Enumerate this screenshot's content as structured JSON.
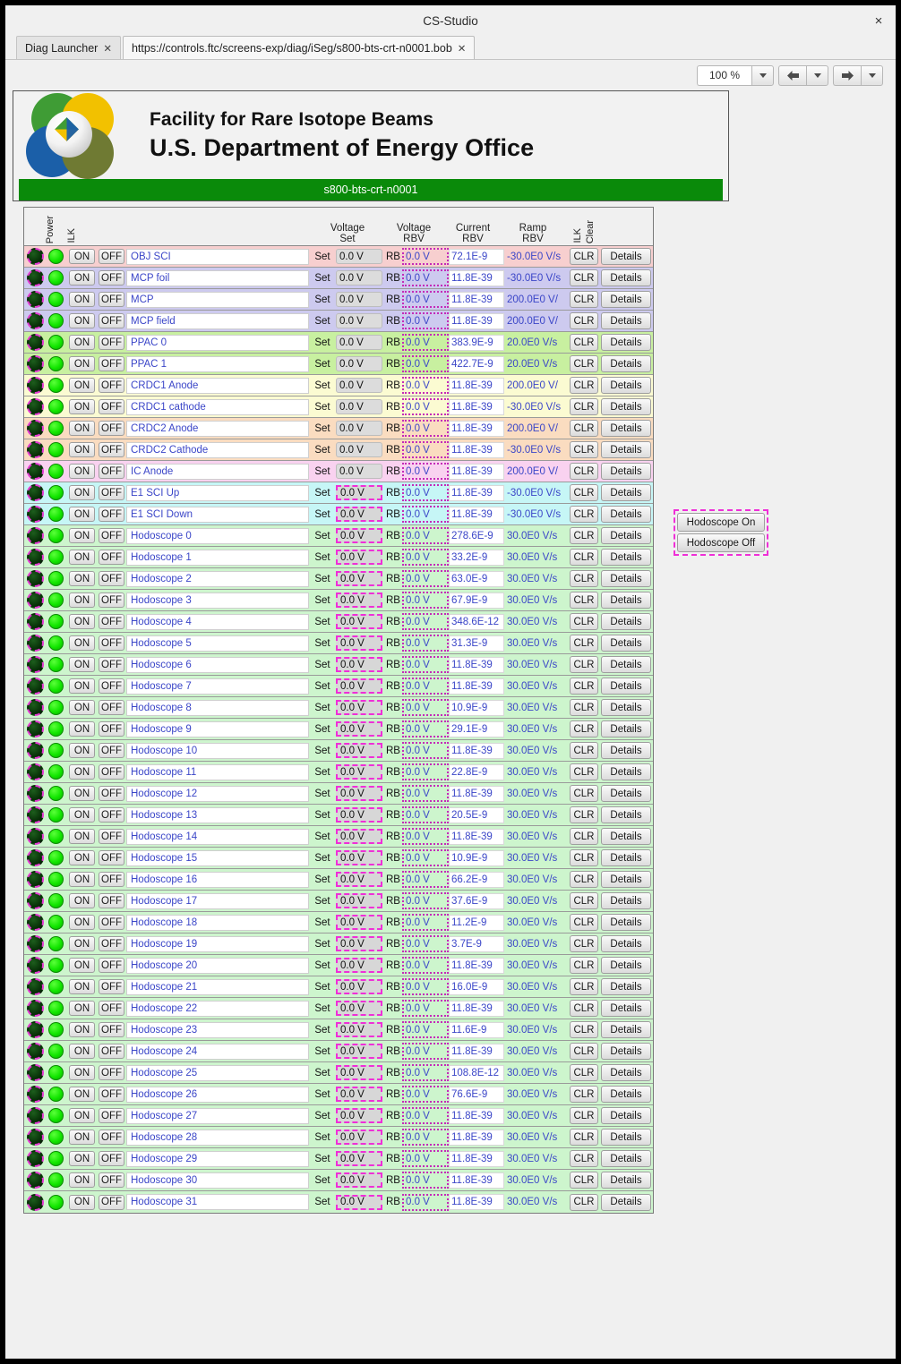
{
  "window": {
    "title": "CS-Studio",
    "close_label": "×"
  },
  "tabs": [
    {
      "label": "Diag Launcher",
      "close": "✕",
      "active": false
    },
    {
      "label": "https://controls.ftc/screens-exp/diag/iSeg/s800-bts-crt-n0001.bob",
      "close": "✕",
      "active": true
    }
  ],
  "toolbar": {
    "zoom_value": "100 %"
  },
  "banner": {
    "line1": "Facility for Rare Isotope Beams",
    "line2": "U.S. Department of Energy Office",
    "status_bar": "s800-bts-crt-n0001",
    "status_color": "#0a8a0a"
  },
  "table": {
    "headers": {
      "power": "Power",
      "ilk": "ILK",
      "voltage_set_1": "Voltage",
      "voltage_set_2": "Set",
      "voltage_rbv_1": "Voltage",
      "voltage_rbv_2": "RBV",
      "current_rbv_1": "Current",
      "current_rbv_2": "RBV",
      "ramp_rbv_1": "Ramp",
      "ramp_rbv_2": "RBV",
      "ilk_clear_1": "ILK",
      "ilk_clear_2": "Clear"
    },
    "labels": {
      "on": "ON",
      "off": "OFF",
      "set": "Set",
      "rb": "RB",
      "clr": "CLR",
      "details": "Details"
    },
    "rows": [
      {
        "name": "OBJ SCI",
        "vset": "0.0 V",
        "vrbv": "0.0 V",
        "crbv": "72.1E-9",
        "rrbv": "-30.0E0 V/s",
        "bg": "#f7cfcf",
        "hl_set": false
      },
      {
        "name": "MCP foil",
        "vset": "0.0 V",
        "vrbv": "0.0 V",
        "crbv": "11.8E-39",
        "rrbv": "-30.0E0 V/s",
        "bg": "#cdcaef",
        "hl_set": false
      },
      {
        "name": "MCP",
        "vset": "0.0 V",
        "vrbv": "0.0 V",
        "crbv": "11.8E-39",
        "rrbv": "200.0E0 V/",
        "bg": "#cdcaef",
        "hl_set": false
      },
      {
        "name": "MCP field",
        "vset": "0.0 V",
        "vrbv": "0.0 V",
        "crbv": "11.8E-39",
        "rrbv": "200.0E0 V/",
        "bg": "#cdcaef",
        "hl_set": false
      },
      {
        "name": "PPAC 0",
        "vset": "0.0 V",
        "vrbv": "0.0 V",
        "crbv": "383.9E-9",
        "rrbv": "20.0E0 V/s",
        "bg": "#c8f0a0",
        "hl_set": false
      },
      {
        "name": "PPAC 1",
        "vset": "0.0 V",
        "vrbv": "0.0 V",
        "crbv": "422.7E-9",
        "rrbv": "20.0E0 V/s",
        "bg": "#c8f0a0",
        "hl_set": false
      },
      {
        "name": "CRDC1 Anode",
        "vset": "0.0 V",
        "vrbv": "0.0 V",
        "crbv": "11.8E-39",
        "rrbv": "200.0E0 V/",
        "bg": "#fbfbd2",
        "hl_set": false
      },
      {
        "name": "CRDC1 cathode",
        "vset": "0.0 V",
        "vrbv": "0.0 V",
        "crbv": "11.8E-39",
        "rrbv": "-30.0E0 V/s",
        "bg": "#fbfbd2",
        "hl_set": false
      },
      {
        "name": "CRDC2 Anode",
        "vset": "0.0 V",
        "vrbv": "0.0 V",
        "crbv": "11.8E-39",
        "rrbv": "200.0E0 V/",
        "bg": "#fadcc0",
        "hl_set": false
      },
      {
        "name": "CRDC2 Cathode",
        "vset": "0.0 V",
        "vrbv": "0.0 V",
        "crbv": "11.8E-39",
        "rrbv": "-30.0E0 V/s",
        "bg": "#fadcc0",
        "hl_set": false
      },
      {
        "name": "IC Anode",
        "vset": "0.0 V",
        "vrbv": "0.0 V",
        "crbv": "11.8E-39",
        "rrbv": "200.0E0 V/",
        "bg": "#f9d2f0",
        "hl_set": false
      },
      {
        "name": "E1 SCI Up",
        "vset": "0.0 V",
        "vrbv": "0.0 V",
        "crbv": "11.8E-39",
        "rrbv": "-30.0E0 V/s",
        "bg": "#c6f6f6",
        "hl_set": true
      },
      {
        "name": "E1 SCI Down",
        "vset": "0.0 V",
        "vrbv": "0.0 V",
        "crbv": "11.8E-39",
        "rrbv": "-30.0E0 V/s",
        "bg": "#c6f6f6",
        "hl_set": true
      },
      {
        "name": "Hodoscope 0",
        "vset": "0.0 V",
        "vrbv": "0.0 V",
        "crbv": "278.6E-9",
        "rrbv": "30.0E0 V/s",
        "bg": "#cdf5cd",
        "hl_set": true
      },
      {
        "name": "Hodoscope 1",
        "vset": "0.0 V",
        "vrbv": "0.0 V",
        "crbv": "33.2E-9",
        "rrbv": "30.0E0 V/s",
        "bg": "#cdf5cd",
        "hl_set": true
      },
      {
        "name": "Hodoscope 2",
        "vset": "0.0 V",
        "vrbv": "0.0 V",
        "crbv": "63.0E-9",
        "rrbv": "30.0E0 V/s",
        "bg": "#cdf5cd",
        "hl_set": true
      },
      {
        "name": "Hodoscope 3",
        "vset": "0.0 V",
        "vrbv": "0.0 V",
        "crbv": "67.9E-9",
        "rrbv": "30.0E0 V/s",
        "bg": "#cdf5cd",
        "hl_set": true
      },
      {
        "name": "Hodoscope 4",
        "vset": "0.0 V",
        "vrbv": "0.0 V",
        "crbv": "348.6E-12",
        "rrbv": "30.0E0 V/s",
        "bg": "#cdf5cd",
        "hl_set": true
      },
      {
        "name": "Hodoscope 5",
        "vset": "0.0 V",
        "vrbv": "0.0 V",
        "crbv": "31.3E-9",
        "rrbv": "30.0E0 V/s",
        "bg": "#cdf5cd",
        "hl_set": true
      },
      {
        "name": "Hodoscope 6",
        "vset": "0.0 V",
        "vrbv": "0.0 V",
        "crbv": "11.8E-39",
        "rrbv": "30.0E0 V/s",
        "bg": "#cdf5cd",
        "hl_set": true
      },
      {
        "name": "Hodoscope 7",
        "vset": "0.0 V",
        "vrbv": "0.0 V",
        "crbv": "11.8E-39",
        "rrbv": "30.0E0 V/s",
        "bg": "#cdf5cd",
        "hl_set": true
      },
      {
        "name": "Hodoscope 8",
        "vset": "0.0 V",
        "vrbv": "0.0 V",
        "crbv": "10.9E-9",
        "rrbv": "30.0E0 V/s",
        "bg": "#cdf5cd",
        "hl_set": true
      },
      {
        "name": "Hodoscope 9",
        "vset": "0.0 V",
        "vrbv": "0.0 V",
        "crbv": "29.1E-9",
        "rrbv": "30.0E0 V/s",
        "bg": "#cdf5cd",
        "hl_set": true
      },
      {
        "name": "Hodoscope 10",
        "vset": "0.0 V",
        "vrbv": "0.0 V",
        "crbv": "11.8E-39",
        "rrbv": "30.0E0 V/s",
        "bg": "#cdf5cd",
        "hl_set": true
      },
      {
        "name": "Hodoscope 11",
        "vset": "0.0 V",
        "vrbv": "0.0 V",
        "crbv": "22.8E-9",
        "rrbv": "30.0E0 V/s",
        "bg": "#cdf5cd",
        "hl_set": true
      },
      {
        "name": "Hodoscope 12",
        "vset": "0.0 V",
        "vrbv": "0.0 V",
        "crbv": "11.8E-39",
        "rrbv": "30.0E0 V/s",
        "bg": "#cdf5cd",
        "hl_set": true
      },
      {
        "name": "Hodoscope 13",
        "vset": "0.0 V",
        "vrbv": "0.0 V",
        "crbv": "20.5E-9",
        "rrbv": "30.0E0 V/s",
        "bg": "#cdf5cd",
        "hl_set": true
      },
      {
        "name": "Hodoscope 14",
        "vset": "0.0 V",
        "vrbv": "0.0 V",
        "crbv": "11.8E-39",
        "rrbv": "30.0E0 V/s",
        "bg": "#cdf5cd",
        "hl_set": true
      },
      {
        "name": "Hodoscope 15",
        "vset": "0.0 V",
        "vrbv": "0.0 V",
        "crbv": "10.9E-9",
        "rrbv": "30.0E0 V/s",
        "bg": "#cdf5cd",
        "hl_set": true
      },
      {
        "name": "Hodoscope 16",
        "vset": "0.0 V",
        "vrbv": "0.0 V",
        "crbv": "66.2E-9",
        "rrbv": "30.0E0 V/s",
        "bg": "#cdf5cd",
        "hl_set": true
      },
      {
        "name": "Hodoscope 17",
        "vset": "0.0 V",
        "vrbv": "0.0 V",
        "crbv": "37.6E-9",
        "rrbv": "30.0E0 V/s",
        "bg": "#cdf5cd",
        "hl_set": true
      },
      {
        "name": "Hodoscope 18",
        "vset": "0.0 V",
        "vrbv": "0.0 V",
        "crbv": "11.2E-9",
        "rrbv": "30.0E0 V/s",
        "bg": "#cdf5cd",
        "hl_set": true
      },
      {
        "name": "Hodoscope 19",
        "vset": "0.0 V",
        "vrbv": "0.0 V",
        "crbv": "3.7E-9",
        "rrbv": "30.0E0 V/s",
        "bg": "#cdf5cd",
        "hl_set": true
      },
      {
        "name": "Hodoscope 20",
        "vset": "0.0 V",
        "vrbv": "0.0 V",
        "crbv": "11.8E-39",
        "rrbv": "30.0E0 V/s",
        "bg": "#cdf5cd",
        "hl_set": true
      },
      {
        "name": "Hodoscope 21",
        "vset": "0.0 V",
        "vrbv": "0.0 V",
        "crbv": "16.0E-9",
        "rrbv": "30.0E0 V/s",
        "bg": "#cdf5cd",
        "hl_set": true
      },
      {
        "name": "Hodoscope 22",
        "vset": "0.0 V",
        "vrbv": "0.0 V",
        "crbv": "11.8E-39",
        "rrbv": "30.0E0 V/s",
        "bg": "#cdf5cd",
        "hl_set": true
      },
      {
        "name": "Hodoscope 23",
        "vset": "0.0 V",
        "vrbv": "0.0 V",
        "crbv": "11.6E-9",
        "rrbv": "30.0E0 V/s",
        "bg": "#cdf5cd",
        "hl_set": true
      },
      {
        "name": "Hodoscope 24",
        "vset": "0.0 V",
        "vrbv": "0.0 V",
        "crbv": "11.8E-39",
        "rrbv": "30.0E0 V/s",
        "bg": "#cdf5cd",
        "hl_set": true
      },
      {
        "name": "Hodoscope 25",
        "vset": "0.0 V",
        "vrbv": "0.0 V",
        "crbv": "108.8E-12",
        "rrbv": "30.0E0 V/s",
        "bg": "#cdf5cd",
        "hl_set": true
      },
      {
        "name": "Hodoscope 26",
        "vset": "0.0 V",
        "vrbv": "0.0 V",
        "crbv": "76.6E-9",
        "rrbv": "30.0E0 V/s",
        "bg": "#cdf5cd",
        "hl_set": true
      },
      {
        "name": "Hodoscope 27",
        "vset": "0.0 V",
        "vrbv": "0.0 V",
        "crbv": "11.8E-39",
        "rrbv": "30.0E0 V/s",
        "bg": "#cdf5cd",
        "hl_set": true
      },
      {
        "name": "Hodoscope 28",
        "vset": "0.0 V",
        "vrbv": "0.0 V",
        "crbv": "11.8E-39",
        "rrbv": "30.0E0 V/s",
        "bg": "#cdf5cd",
        "hl_set": true
      },
      {
        "name": "Hodoscope 29",
        "vset": "0.0 V",
        "vrbv": "0.0 V",
        "crbv": "11.8E-39",
        "rrbv": "30.0E0 V/s",
        "bg": "#cdf5cd",
        "hl_set": true
      },
      {
        "name": "Hodoscope 30",
        "vset": "0.0 V",
        "vrbv": "0.0 V",
        "crbv": "11.8E-39",
        "rrbv": "30.0E0 V/s",
        "bg": "#cdf5cd",
        "hl_set": true
      },
      {
        "name": "Hodoscope 31",
        "vset": "0.0 V",
        "vrbv": "0.0 V",
        "crbv": "11.8E-39",
        "rrbv": "30.0E0 V/s",
        "bg": "#cdf5cd",
        "hl_set": true
      }
    ]
  },
  "side_buttons": [
    {
      "label": "Hodoscope On"
    },
    {
      "label": "Hodoscope Off"
    }
  ]
}
